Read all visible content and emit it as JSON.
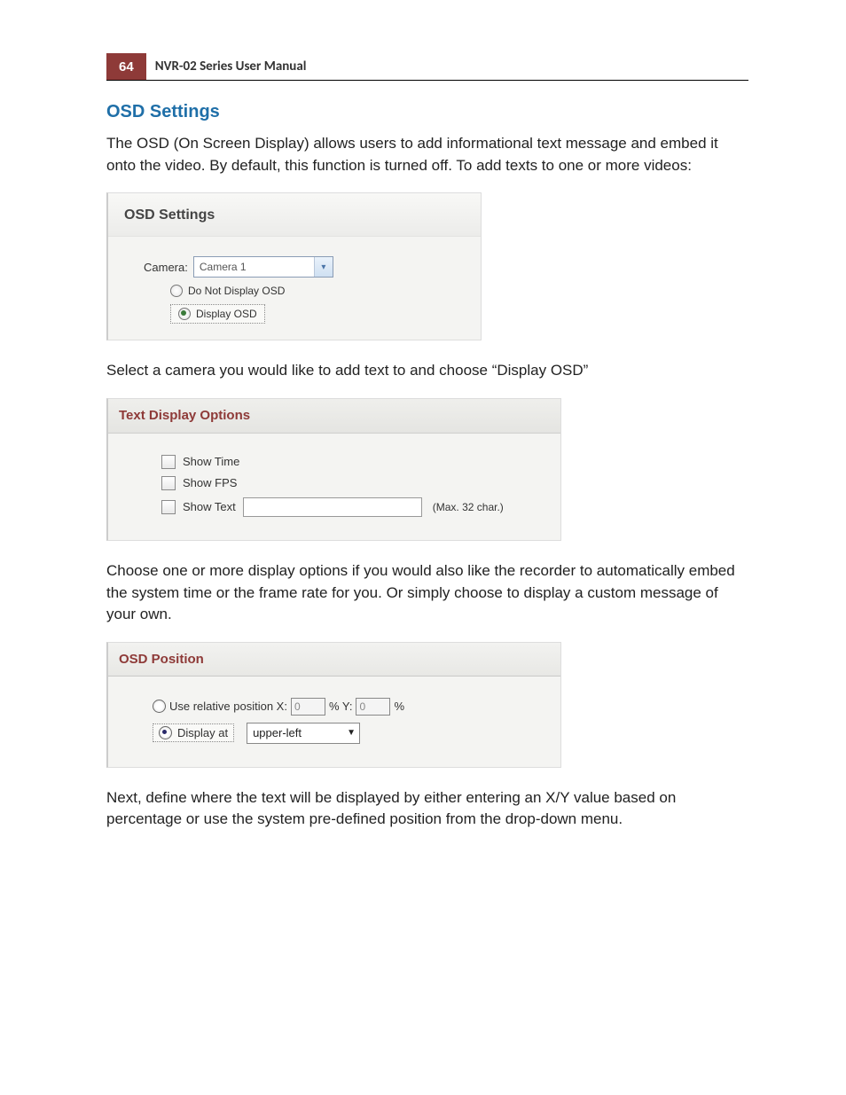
{
  "header": {
    "page_number": "64",
    "doc_title": "NVR-02 Series User Manual"
  },
  "section_title": "OSD Settings",
  "intro_text": "The OSD (On Screen Display) allows users to add informational text message and embed it onto the video. By default, this function is turned off. To add texts to one or more videos:",
  "panel1": {
    "title": "OSD Settings",
    "camera_label": "Camera:",
    "camera_value": "Camera 1",
    "radio_not_display": "Do Not Display OSD",
    "radio_display": "Display OSD"
  },
  "text_after_panel1": "Select a camera you would like to add text to and choose “Display OSD”",
  "panel2": {
    "title": "Text Display Options",
    "show_time": "Show Time",
    "show_fps": "Show FPS",
    "show_text": "Show Text",
    "max_note": "(Max. 32 char.)"
  },
  "text_after_panel2": "Choose one or more display options if you would also like the recorder to automatically embed the system time or the frame rate for you. Or simply choose to display a custom message of your own.",
  "panel3": {
    "title": "OSD Position",
    "use_relative": "Use relative position X:",
    "x_value": "0",
    "pct_y": "% Y:",
    "y_value": "0",
    "pct": "%",
    "display_at": "Display at",
    "position_value": "upper-left"
  },
  "text_after_panel3": "Next, define where the text will be displayed by either entering an X/Y value based on percentage or use the system pre-defined position from the drop-down menu."
}
